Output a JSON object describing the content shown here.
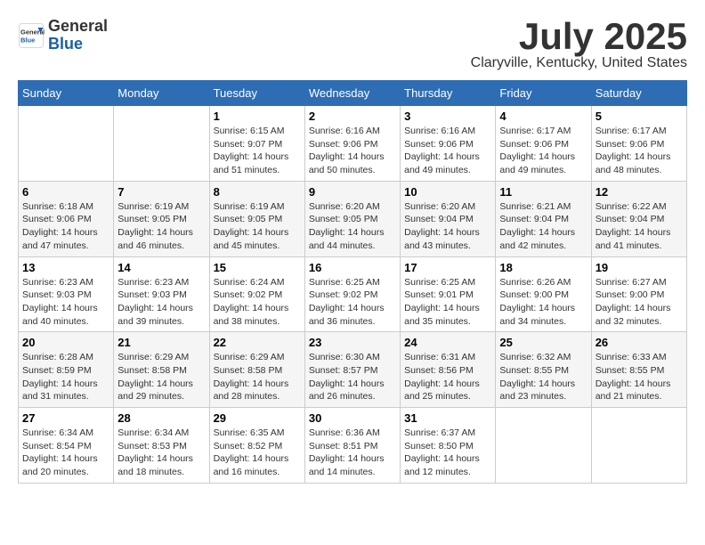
{
  "header": {
    "logo": {
      "general": "General",
      "blue": "Blue"
    },
    "title": "July 2025",
    "location": "Claryville, Kentucky, United States"
  },
  "calendar": {
    "days_of_week": [
      "Sunday",
      "Monday",
      "Tuesday",
      "Wednesday",
      "Thursday",
      "Friday",
      "Saturday"
    ],
    "weeks": [
      [
        {
          "day": "",
          "content": ""
        },
        {
          "day": "",
          "content": ""
        },
        {
          "day": "1",
          "content": "Sunrise: 6:15 AM\nSunset: 9:07 PM\nDaylight: 14 hours and 51 minutes."
        },
        {
          "day": "2",
          "content": "Sunrise: 6:16 AM\nSunset: 9:06 PM\nDaylight: 14 hours and 50 minutes."
        },
        {
          "day": "3",
          "content": "Sunrise: 6:16 AM\nSunset: 9:06 PM\nDaylight: 14 hours and 49 minutes."
        },
        {
          "day": "4",
          "content": "Sunrise: 6:17 AM\nSunset: 9:06 PM\nDaylight: 14 hours and 49 minutes."
        },
        {
          "day": "5",
          "content": "Sunrise: 6:17 AM\nSunset: 9:06 PM\nDaylight: 14 hours and 48 minutes."
        }
      ],
      [
        {
          "day": "6",
          "content": "Sunrise: 6:18 AM\nSunset: 9:06 PM\nDaylight: 14 hours and 47 minutes."
        },
        {
          "day": "7",
          "content": "Sunrise: 6:19 AM\nSunset: 9:05 PM\nDaylight: 14 hours and 46 minutes."
        },
        {
          "day": "8",
          "content": "Sunrise: 6:19 AM\nSunset: 9:05 PM\nDaylight: 14 hours and 45 minutes."
        },
        {
          "day": "9",
          "content": "Sunrise: 6:20 AM\nSunset: 9:05 PM\nDaylight: 14 hours and 44 minutes."
        },
        {
          "day": "10",
          "content": "Sunrise: 6:20 AM\nSunset: 9:04 PM\nDaylight: 14 hours and 43 minutes."
        },
        {
          "day": "11",
          "content": "Sunrise: 6:21 AM\nSunset: 9:04 PM\nDaylight: 14 hours and 42 minutes."
        },
        {
          "day": "12",
          "content": "Sunrise: 6:22 AM\nSunset: 9:04 PM\nDaylight: 14 hours and 41 minutes."
        }
      ],
      [
        {
          "day": "13",
          "content": "Sunrise: 6:23 AM\nSunset: 9:03 PM\nDaylight: 14 hours and 40 minutes."
        },
        {
          "day": "14",
          "content": "Sunrise: 6:23 AM\nSunset: 9:03 PM\nDaylight: 14 hours and 39 minutes."
        },
        {
          "day": "15",
          "content": "Sunrise: 6:24 AM\nSunset: 9:02 PM\nDaylight: 14 hours and 38 minutes."
        },
        {
          "day": "16",
          "content": "Sunrise: 6:25 AM\nSunset: 9:02 PM\nDaylight: 14 hours and 36 minutes."
        },
        {
          "day": "17",
          "content": "Sunrise: 6:25 AM\nSunset: 9:01 PM\nDaylight: 14 hours and 35 minutes."
        },
        {
          "day": "18",
          "content": "Sunrise: 6:26 AM\nSunset: 9:00 PM\nDaylight: 14 hours and 34 minutes."
        },
        {
          "day": "19",
          "content": "Sunrise: 6:27 AM\nSunset: 9:00 PM\nDaylight: 14 hours and 32 minutes."
        }
      ],
      [
        {
          "day": "20",
          "content": "Sunrise: 6:28 AM\nSunset: 8:59 PM\nDaylight: 14 hours and 31 minutes."
        },
        {
          "day": "21",
          "content": "Sunrise: 6:29 AM\nSunset: 8:58 PM\nDaylight: 14 hours and 29 minutes."
        },
        {
          "day": "22",
          "content": "Sunrise: 6:29 AM\nSunset: 8:58 PM\nDaylight: 14 hours and 28 minutes."
        },
        {
          "day": "23",
          "content": "Sunrise: 6:30 AM\nSunset: 8:57 PM\nDaylight: 14 hours and 26 minutes."
        },
        {
          "day": "24",
          "content": "Sunrise: 6:31 AM\nSunset: 8:56 PM\nDaylight: 14 hours and 25 minutes."
        },
        {
          "day": "25",
          "content": "Sunrise: 6:32 AM\nSunset: 8:55 PM\nDaylight: 14 hours and 23 minutes."
        },
        {
          "day": "26",
          "content": "Sunrise: 6:33 AM\nSunset: 8:55 PM\nDaylight: 14 hours and 21 minutes."
        }
      ],
      [
        {
          "day": "27",
          "content": "Sunrise: 6:34 AM\nSunset: 8:54 PM\nDaylight: 14 hours and 20 minutes."
        },
        {
          "day": "28",
          "content": "Sunrise: 6:34 AM\nSunset: 8:53 PM\nDaylight: 14 hours and 18 minutes."
        },
        {
          "day": "29",
          "content": "Sunrise: 6:35 AM\nSunset: 8:52 PM\nDaylight: 14 hours and 16 minutes."
        },
        {
          "day": "30",
          "content": "Sunrise: 6:36 AM\nSunset: 8:51 PM\nDaylight: 14 hours and 14 minutes."
        },
        {
          "day": "31",
          "content": "Sunrise: 6:37 AM\nSunset: 8:50 PM\nDaylight: 14 hours and 12 minutes."
        },
        {
          "day": "",
          "content": ""
        },
        {
          "day": "",
          "content": ""
        }
      ]
    ]
  }
}
